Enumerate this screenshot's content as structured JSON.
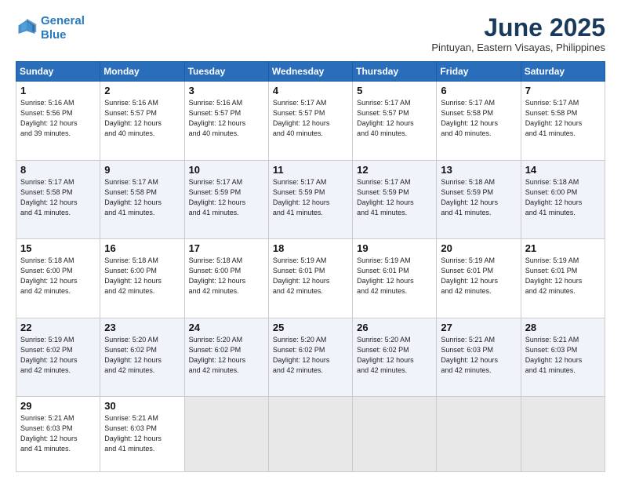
{
  "header": {
    "logo_line1": "General",
    "logo_line2": "Blue",
    "title": "June 2025",
    "subtitle": "Pintuyan, Eastern Visayas, Philippines"
  },
  "weekdays": [
    "Sunday",
    "Monday",
    "Tuesday",
    "Wednesday",
    "Thursday",
    "Friday",
    "Saturday"
  ],
  "weeks": [
    [
      {
        "day": "1",
        "info": "Sunrise: 5:16 AM\nSunset: 5:56 PM\nDaylight: 12 hours\nand 39 minutes."
      },
      {
        "day": "2",
        "info": "Sunrise: 5:16 AM\nSunset: 5:57 PM\nDaylight: 12 hours\nand 40 minutes."
      },
      {
        "day": "3",
        "info": "Sunrise: 5:16 AM\nSunset: 5:57 PM\nDaylight: 12 hours\nand 40 minutes."
      },
      {
        "day": "4",
        "info": "Sunrise: 5:17 AM\nSunset: 5:57 PM\nDaylight: 12 hours\nand 40 minutes."
      },
      {
        "day": "5",
        "info": "Sunrise: 5:17 AM\nSunset: 5:57 PM\nDaylight: 12 hours\nand 40 minutes."
      },
      {
        "day": "6",
        "info": "Sunrise: 5:17 AM\nSunset: 5:58 PM\nDaylight: 12 hours\nand 40 minutes."
      },
      {
        "day": "7",
        "info": "Sunrise: 5:17 AM\nSunset: 5:58 PM\nDaylight: 12 hours\nand 41 minutes."
      }
    ],
    [
      {
        "day": "8",
        "info": "Sunrise: 5:17 AM\nSunset: 5:58 PM\nDaylight: 12 hours\nand 41 minutes."
      },
      {
        "day": "9",
        "info": "Sunrise: 5:17 AM\nSunset: 5:58 PM\nDaylight: 12 hours\nand 41 minutes."
      },
      {
        "day": "10",
        "info": "Sunrise: 5:17 AM\nSunset: 5:59 PM\nDaylight: 12 hours\nand 41 minutes."
      },
      {
        "day": "11",
        "info": "Sunrise: 5:17 AM\nSunset: 5:59 PM\nDaylight: 12 hours\nand 41 minutes."
      },
      {
        "day": "12",
        "info": "Sunrise: 5:17 AM\nSunset: 5:59 PM\nDaylight: 12 hours\nand 41 minutes."
      },
      {
        "day": "13",
        "info": "Sunrise: 5:18 AM\nSunset: 5:59 PM\nDaylight: 12 hours\nand 41 minutes."
      },
      {
        "day": "14",
        "info": "Sunrise: 5:18 AM\nSunset: 6:00 PM\nDaylight: 12 hours\nand 41 minutes."
      }
    ],
    [
      {
        "day": "15",
        "info": "Sunrise: 5:18 AM\nSunset: 6:00 PM\nDaylight: 12 hours\nand 42 minutes."
      },
      {
        "day": "16",
        "info": "Sunrise: 5:18 AM\nSunset: 6:00 PM\nDaylight: 12 hours\nand 42 minutes."
      },
      {
        "day": "17",
        "info": "Sunrise: 5:18 AM\nSunset: 6:00 PM\nDaylight: 12 hours\nand 42 minutes."
      },
      {
        "day": "18",
        "info": "Sunrise: 5:19 AM\nSunset: 6:01 PM\nDaylight: 12 hours\nand 42 minutes."
      },
      {
        "day": "19",
        "info": "Sunrise: 5:19 AM\nSunset: 6:01 PM\nDaylight: 12 hours\nand 42 minutes."
      },
      {
        "day": "20",
        "info": "Sunrise: 5:19 AM\nSunset: 6:01 PM\nDaylight: 12 hours\nand 42 minutes."
      },
      {
        "day": "21",
        "info": "Sunrise: 5:19 AM\nSunset: 6:01 PM\nDaylight: 12 hours\nand 42 minutes."
      }
    ],
    [
      {
        "day": "22",
        "info": "Sunrise: 5:19 AM\nSunset: 6:02 PM\nDaylight: 12 hours\nand 42 minutes."
      },
      {
        "day": "23",
        "info": "Sunrise: 5:20 AM\nSunset: 6:02 PM\nDaylight: 12 hours\nand 42 minutes."
      },
      {
        "day": "24",
        "info": "Sunrise: 5:20 AM\nSunset: 6:02 PM\nDaylight: 12 hours\nand 42 minutes."
      },
      {
        "day": "25",
        "info": "Sunrise: 5:20 AM\nSunset: 6:02 PM\nDaylight: 12 hours\nand 42 minutes."
      },
      {
        "day": "26",
        "info": "Sunrise: 5:20 AM\nSunset: 6:02 PM\nDaylight: 12 hours\nand 42 minutes."
      },
      {
        "day": "27",
        "info": "Sunrise: 5:21 AM\nSunset: 6:03 PM\nDaylight: 12 hours\nand 42 minutes."
      },
      {
        "day": "28",
        "info": "Sunrise: 5:21 AM\nSunset: 6:03 PM\nDaylight: 12 hours\nand 41 minutes."
      }
    ],
    [
      {
        "day": "29",
        "info": "Sunrise: 5:21 AM\nSunset: 6:03 PM\nDaylight: 12 hours\nand 41 minutes."
      },
      {
        "day": "30",
        "info": "Sunrise: 5:21 AM\nSunset: 6:03 PM\nDaylight: 12 hours\nand 41 minutes."
      },
      {
        "day": "",
        "info": ""
      },
      {
        "day": "",
        "info": ""
      },
      {
        "day": "",
        "info": ""
      },
      {
        "day": "",
        "info": ""
      },
      {
        "day": "",
        "info": ""
      }
    ]
  ]
}
